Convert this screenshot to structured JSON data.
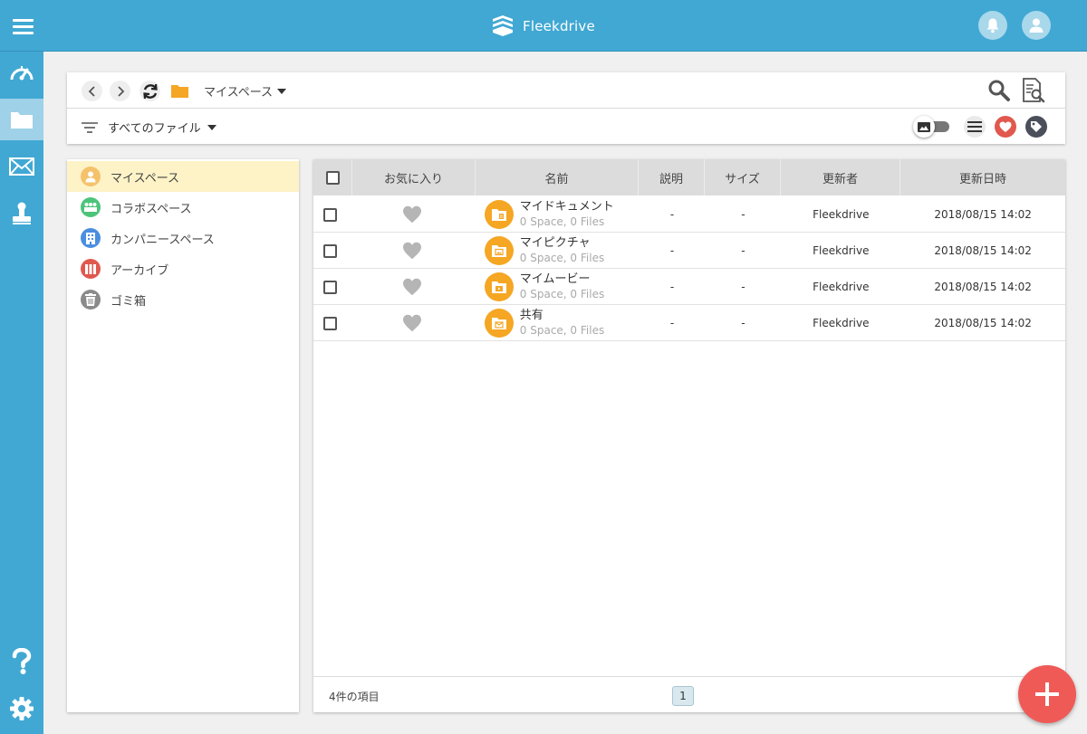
{
  "app": {
    "name": "Fleekdrive"
  },
  "colors": {
    "primary": "#41a8d3",
    "folder": "#f5a623",
    "fab": "#ef5a57",
    "active_nav": "#fdf3c7"
  },
  "header": {
    "icons": [
      "menu-icon",
      "bell-icon",
      "user-icon"
    ]
  },
  "rail": {
    "items": [
      "dashboard-icon",
      "folder-icon",
      "mail-icon",
      "stamp-icon",
      "help-icon",
      "settings-icon"
    ]
  },
  "toolbar": {
    "breadcrumb": "マイスペース",
    "filter": "すべてのファイル"
  },
  "sidebar": {
    "items": [
      {
        "label": "マイスペース",
        "icon": "user-icon",
        "color": "#f5c26b",
        "active": true
      },
      {
        "label": "コラボスペース",
        "icon": "group-icon",
        "color": "#4cc47a",
        "active": false
      },
      {
        "label": "カンパニースペース",
        "icon": "building-icon",
        "color": "#4a8ee0",
        "active": false
      },
      {
        "label": "アーカイブ",
        "icon": "archive-icon",
        "color": "#e0584e",
        "active": false
      },
      {
        "label": "ゴミ箱",
        "icon": "trash-icon",
        "color": "#8a8a8a",
        "active": false
      }
    ]
  },
  "table": {
    "headers": {
      "favorite": "お気に入り",
      "name": "名前",
      "description": "説明",
      "size": "サイズ",
      "updater": "更新者",
      "updated": "更新日時"
    },
    "rows": [
      {
        "name": "マイドキュメント",
        "sub": "0 Space, 0 Files",
        "description": "-",
        "size": "-",
        "updater": "Fleekdrive",
        "updated": "2018/08/15 14:02",
        "icon": "document-folder-icon"
      },
      {
        "name": "マイピクチャ",
        "sub": "0 Space, 0 Files",
        "description": "-",
        "size": "-",
        "updater": "Fleekdrive",
        "updated": "2018/08/15 14:02",
        "icon": "picture-folder-icon"
      },
      {
        "name": "マイムービー",
        "sub": "0 Space, 0 Files",
        "description": "-",
        "size": "-",
        "updater": "Fleekdrive",
        "updated": "2018/08/15 14:02",
        "icon": "movie-folder-icon"
      },
      {
        "name": "共有",
        "sub": "0 Space, 0 Files",
        "description": "-",
        "size": "-",
        "updater": "Fleekdrive",
        "updated": "2018/08/15 14:02",
        "icon": "shared-folder-icon"
      }
    ],
    "footer": {
      "count": "4件の項目",
      "page": "1"
    }
  }
}
